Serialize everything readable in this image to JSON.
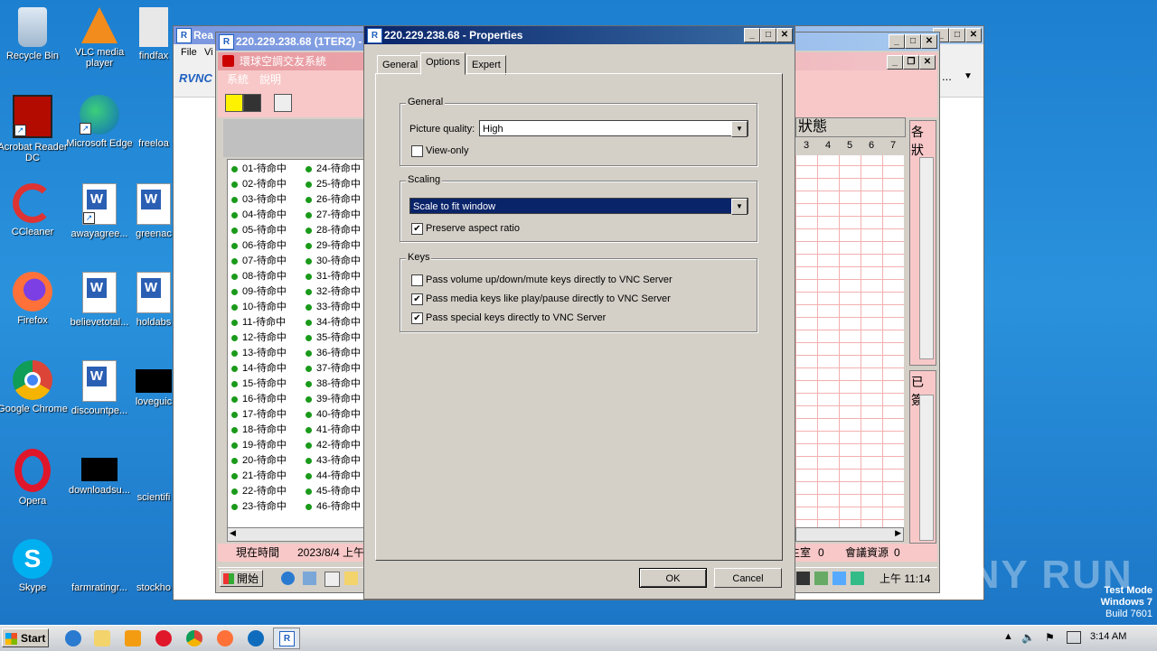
{
  "desktop": {
    "icons": [
      {
        "label": "Recycle Bin"
      },
      {
        "label": "VLC media player"
      },
      {
        "label": "findfax"
      },
      {
        "label": "Acrobat Reader DC"
      },
      {
        "label": "Microsoft Edge"
      },
      {
        "label": "freeloa"
      },
      {
        "label": "CCleaner"
      },
      {
        "label": "awayagree..."
      },
      {
        "label": "greenac"
      },
      {
        "label": "Firefox"
      },
      {
        "label": "believetotal..."
      },
      {
        "label": "holdabs"
      },
      {
        "label": "Google Chrome"
      },
      {
        "label": "discountpe..."
      },
      {
        "label": "loveguic"
      },
      {
        "label": "Opera"
      },
      {
        "label": "downloadsu..."
      },
      {
        "label": "scientifi"
      },
      {
        "label": "Skype"
      },
      {
        "label": "farmratingr..."
      },
      {
        "label": "stockho"
      }
    ],
    "watermark": {
      "brand": "ANY RUN",
      "mode": "Test Mode",
      "os": "Windows 7",
      "build": "Build 7601"
    }
  },
  "viewer_window": {
    "title": "Rea",
    "menu": [
      "File",
      "Vi"
    ],
    "logo": "RVNC",
    "more_label": "..."
  },
  "remote_window": {
    "title": "220.229.238.68 (1TER2) -",
    "app_title": "環球空調交友系統",
    "menu": [
      "系統",
      "說明"
    ],
    "status_header": "狀態",
    "grid_cols": [
      "3",
      "4",
      "5",
      "6",
      "7"
    ],
    "side_header_1": "各狀",
    "side_header_2": "已簽",
    "rows_left": [
      "01-待命中",
      "02-待命中",
      "03-待命中",
      "04-待命中",
      "05-待命中",
      "06-待命中",
      "07-待命中",
      "08-待命中",
      "09-待命中",
      "10-待命中",
      "11-待命中",
      "12-待命中",
      "13-待命中",
      "14-待命中",
      "15-待命中",
      "16-待命中",
      "17-待命中",
      "18-待命中",
      "19-待命中",
      "20-待命中",
      "21-待命中",
      "22-待命中",
      "23-待命中"
    ],
    "rows_right": [
      "24-待命中",
      "25-待命中",
      "26-待命中",
      "27-待命中",
      "28-待命中",
      "29-待命中",
      "30-待命中",
      "31-待命中",
      "32-待命中",
      "33-待命中",
      "34-待命中",
      "35-待命中",
      "36-待命中",
      "37-待命中",
      "38-待命中",
      "39-待命中",
      "40-待命中",
      "41-待命中",
      "42-待命中",
      "43-待命中",
      "44-待命中",
      "45-待命中",
      "46-待命中"
    ],
    "status_time_label": "現在時間",
    "status_time_value": "2023/8/4 上午",
    "status_room_label": "主室",
    "status_room_value": "0",
    "status_res_label": "會議資源",
    "status_res_value": "0",
    "start_label": "開始",
    "clock": "上午 11:14"
  },
  "dialog": {
    "title": "220.229.238.68 - Properties",
    "tabs": [
      "General",
      "Options",
      "Expert"
    ],
    "active_tab": "Options",
    "general": {
      "label": "General",
      "picture_quality_label": "Picture quality:",
      "picture_quality_value": "High",
      "view_only_label": "View-only",
      "view_only_checked": false
    },
    "scaling": {
      "label": "Scaling",
      "value": "Scale to fit window",
      "preserve_label": "Preserve aspect ratio",
      "preserve_checked": true
    },
    "keys": {
      "label": "Keys",
      "items": [
        {
          "label": "Pass volume up/down/mute keys directly to VNC Server",
          "checked": false
        },
        {
          "label": "Pass media keys like play/pause directly to VNC Server",
          "checked": true
        },
        {
          "label": "Pass special keys directly to VNC Server",
          "checked": true
        }
      ]
    },
    "ok_label": "OK",
    "cancel_label": "Cancel"
  },
  "taskbar": {
    "start_label": "Start",
    "time": "3:14 AM"
  }
}
